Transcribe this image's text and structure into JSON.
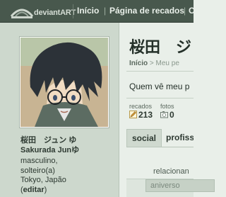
{
  "header": {
    "logo_text": "deviantART",
    "nav": [
      "Início",
      "Página de recados",
      "C"
    ]
  },
  "profile": {
    "name_line1": "桜田　ジュン ゆ",
    "name_line2": "Sakurada Junゆ",
    "info_line1": "masculino,",
    "info_line2": "solteiro(a)",
    "info_line3": "Tokyo, Japão",
    "edit_open": "(",
    "edit_label": "editar",
    "edit_close": ")"
  },
  "main": {
    "title": "桜田　ジ",
    "breadcrumb_home": "Início",
    "breadcrumb_sep": " > ",
    "breadcrumb_rest": "Meu pe",
    "who_sees": "Quem vê meu p",
    "stats": [
      {
        "label": "recados",
        "value": "213",
        "icon": "pencil-icon"
      },
      {
        "label": "fotos",
        "value": "0",
        "icon": "camera-icon"
      }
    ],
    "tabs": [
      "social",
      "profiss"
    ],
    "relationship": "relacionan",
    "birthday": "aniverso"
  }
}
